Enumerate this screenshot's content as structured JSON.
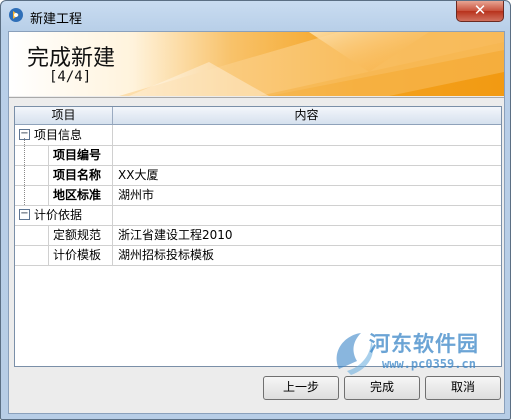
{
  "window": {
    "title": "新建工程",
    "close_label": "✕"
  },
  "banner": {
    "title": "完成新建",
    "step": "[4/4]"
  },
  "grid": {
    "columns": [
      "项目",
      "内容"
    ],
    "rows": [
      {
        "type": "group",
        "expander": "−",
        "label": "项目信息",
        "value": ""
      },
      {
        "type": "item",
        "bold": true,
        "label": "项目编号",
        "value": ""
      },
      {
        "type": "item",
        "bold": true,
        "label": "项目名称",
        "value": "XX大厦"
      },
      {
        "type": "item",
        "bold": true,
        "label": "地区标准",
        "value": "湖州市"
      },
      {
        "type": "group",
        "expander": "−",
        "label": "计价依据",
        "value": ""
      },
      {
        "type": "item",
        "bold": false,
        "label": "定额规范",
        "value": "浙江省建设工程2010"
      },
      {
        "type": "item",
        "bold": false,
        "label": "计价模板",
        "value": "湖州招标投标模板"
      }
    ]
  },
  "buttons": {
    "prev": "上一步",
    "finish": "完成",
    "cancel": "取消"
  },
  "watermark": {
    "text": "河东软件园",
    "url": "www.pc0359.cn"
  },
  "colors": {
    "banner_orange": "#f4a21f",
    "watermark_blue": "#3a86c8"
  }
}
